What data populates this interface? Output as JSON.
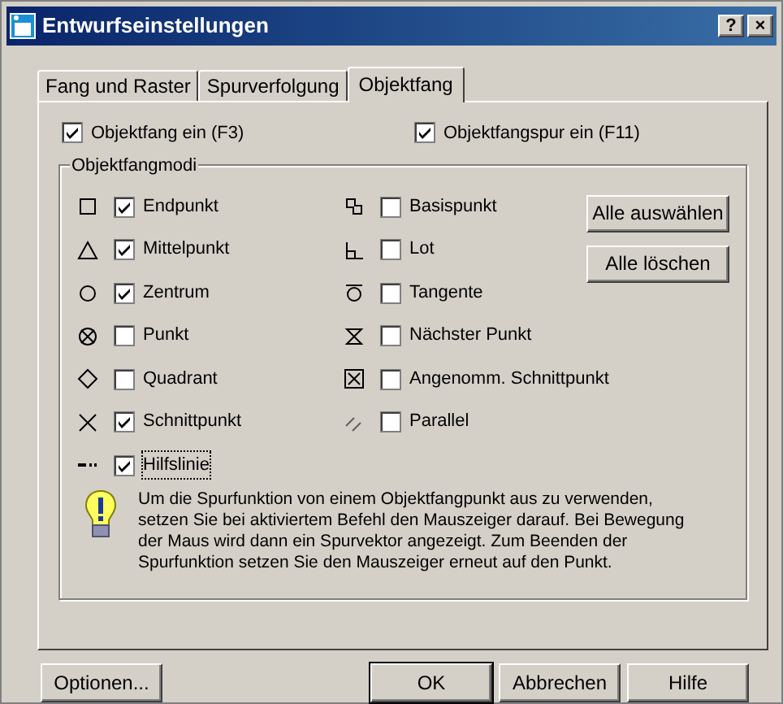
{
  "window": {
    "title": "Entwurfseinstellungen",
    "buttons": [
      "?",
      "×"
    ]
  },
  "tabs": [
    {
      "label": "Fang und Raster",
      "selected": false
    },
    {
      "label": "Spurverfolgung",
      "selected": false
    },
    {
      "label": "Objektfang",
      "selected": true
    }
  ],
  "toggles": [
    {
      "label": "Objektfang ein (F3)",
      "checked": true
    },
    {
      "label": "Objektfangspur ein (F11)",
      "checked": true
    }
  ],
  "group": {
    "title": "Objektfangmodi",
    "left_modes": [
      {
        "kind": "square",
        "label": "Endpunkt",
        "checked": true
      },
      {
        "kind": "triangle",
        "label": "Mittelpunkt",
        "checked": true
      },
      {
        "kind": "circle",
        "label": "Zentrum",
        "checked": true
      },
      {
        "kind": "node",
        "label": "Punkt",
        "checked": false
      },
      {
        "kind": "diamond",
        "label": "Quadrant",
        "checked": false
      },
      {
        "kind": "cross",
        "label": "Schnittpunkt",
        "checked": true
      },
      {
        "kind": "extension",
        "label": "Hilfslinie",
        "checked": true,
        "focused": true
      }
    ],
    "right_modes": [
      {
        "kind": "insertion",
        "label": "Basispunkt",
        "checked": false
      },
      {
        "kind": "perpendicular",
        "label": "Lot",
        "checked": false
      },
      {
        "kind": "tangent",
        "label": "Tangente",
        "checked": false
      },
      {
        "kind": "nearest",
        "label": "Nächster Punkt",
        "checked": false
      },
      {
        "kind": "apparent",
        "label": "Angenomm. Schnittpunkt",
        "checked": false
      },
      {
        "kind": "parallel",
        "label": "Parallel",
        "checked": false
      }
    ],
    "buttons": [
      "Alle auswählen",
      "Alle löschen"
    ],
    "hint": "Um die Spurfunktion von einem Objektfangpunkt aus zu verwenden, setzen Sie bei aktiviertem Befehl den Mauszeiger darauf. Bei Bewegung der Maus wird dann ein Spurvektor angezeigt. Zum Beenden der Spurfunktion setzen Sie den Mauszeiger erneut auf den Punkt."
  },
  "footer_buttons": [
    {
      "label": "Optionen...",
      "default": false
    },
    {
      "label": "OK",
      "default": true
    },
    {
      "label": "Abbrechen",
      "default": false
    },
    {
      "label": "Hilfe",
      "default": false
    }
  ]
}
